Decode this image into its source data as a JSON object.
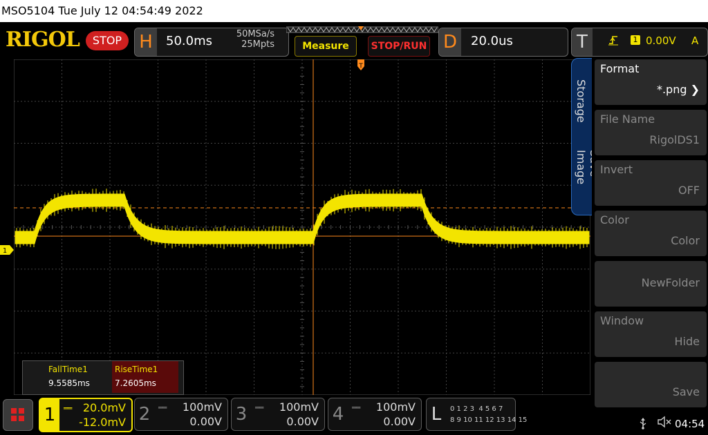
{
  "title_bar": {
    "text": "MSO5104  Tue July 12 04:54:49 2022"
  },
  "header": {
    "logo": "RIGOL",
    "run_state": "STOP",
    "horizontal": {
      "letter": "H",
      "timebase": "50.0ms",
      "sample_rate": "50MSa/s",
      "memory_depth": "25Mpts"
    },
    "measure_button": "Measure",
    "stop_run_button": "STOP/RUN",
    "delay": {
      "letter": "D",
      "value": "20.0us"
    },
    "trigger": {
      "letter": "T",
      "source": "1",
      "level": "0.00V",
      "mode": "A",
      "edge_icon": "rising-edge-icon"
    }
  },
  "menu": {
    "tabs": [
      "Storage",
      "Save Image"
    ],
    "items": [
      {
        "label": "Format",
        "value": "*.png",
        "enabled": true
      },
      {
        "label": "File Name",
        "value": "RigolDS1",
        "enabled": false
      },
      {
        "label": "Invert",
        "value": "OFF",
        "enabled": false
      },
      {
        "label": "Color",
        "value": "Color",
        "enabled": false
      },
      {
        "label": "",
        "value": "NewFolder",
        "enabled": false
      },
      {
        "label": "Window",
        "value": "Hide",
        "enabled": false
      },
      {
        "label": "",
        "value": "Save",
        "enabled": false
      }
    ]
  },
  "measurements": {
    "fall": {
      "label": "FallTime1",
      "value": "9.5585ms"
    },
    "rise": {
      "label": "RiseTime1",
      "value": "7.2605ms"
    }
  },
  "channels": [
    {
      "num": "1",
      "scale": "20.0mV",
      "offset": "-12.0mV",
      "active": true,
      "color": "#f3e400"
    },
    {
      "num": "2",
      "scale": "100mV",
      "offset": "0.00V",
      "active": false
    },
    {
      "num": "3",
      "scale": "100mV",
      "offset": "0.00V",
      "active": false
    },
    {
      "num": "4",
      "scale": "100mV",
      "offset": "0.00V",
      "active": false
    }
  ],
  "logic": {
    "letter": "L",
    "row1": "0 1 2 3  4 5 6 7",
    "row2": "8 9 10 11 12 13 14 15"
  },
  "status": {
    "time": "04:54",
    "usb_icon": "usb-icon",
    "speaker_icon": "speaker-muted-icon"
  },
  "ch1_marker": "1",
  "trigger_marker": "T",
  "colors": {
    "trace": "#f3e400",
    "cursor": "#ff8a1c",
    "accent_blue": "#2a6ac0"
  }
}
